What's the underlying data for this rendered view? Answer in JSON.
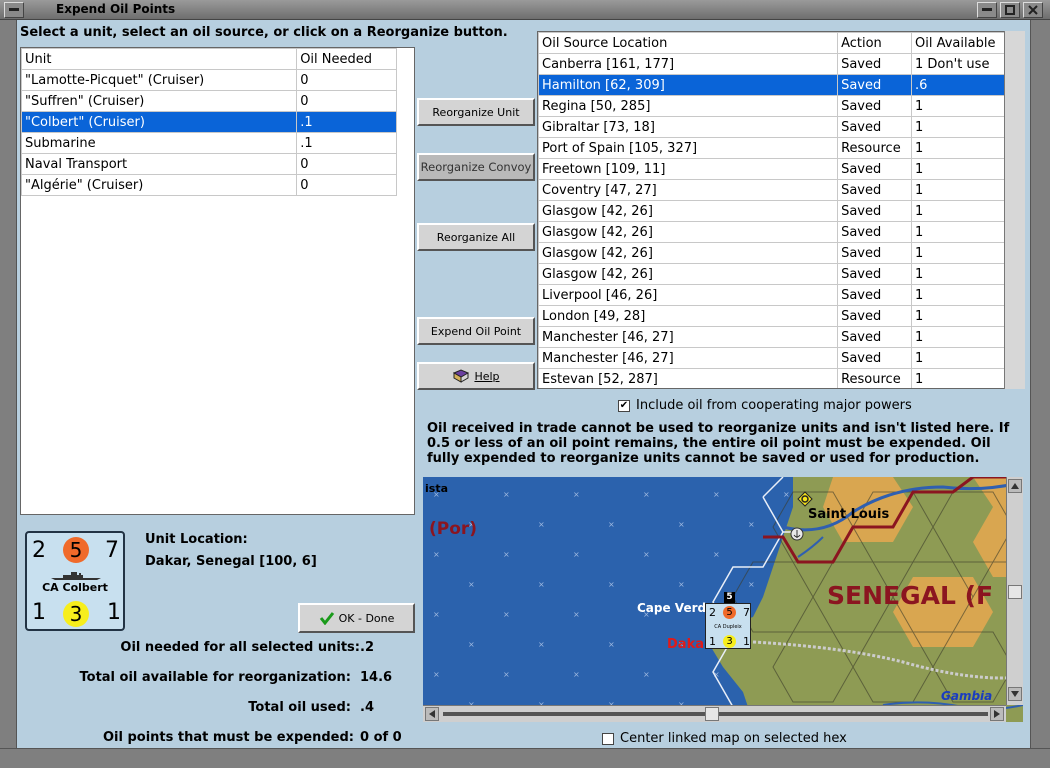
{
  "window": {
    "title": "Expend Oil Points"
  },
  "instructions": "Select a unit, select an oil source, or click on a Reorganize button.",
  "unit_table": {
    "headers": [
      "Unit",
      "Oil Needed"
    ],
    "rows": [
      {
        "unit": "\"Lamotte-Picquet\" (Cruiser)",
        "oil": "0"
      },
      {
        "unit": "\"Suffren\" (Cruiser)",
        "oil": "0"
      },
      {
        "unit": "\"Colbert\" (Cruiser)",
        "oil": ".1",
        "selected": true
      },
      {
        "unit": "Submarine",
        "oil": ".1"
      },
      {
        "unit": "Naval Transport",
        "oil": "0"
      },
      {
        "unit": "\"Algérie\" (Cruiser)",
        "oil": "0"
      }
    ]
  },
  "oil_table": {
    "headers": [
      "Oil Source Location",
      "Action",
      "Oil Available"
    ],
    "rows": [
      {
        "loc": "Canberra [161, 177]",
        "action": "Saved",
        "avail": "1 Don't use"
      },
      {
        "loc": "Hamilton [62, 309]",
        "action": "Saved",
        "avail": ".6",
        "selected": true
      },
      {
        "loc": "Regina [50, 285]",
        "action": "Saved",
        "avail": "1"
      },
      {
        "loc": "Gibraltar [73, 18]",
        "action": "Saved",
        "avail": "1"
      },
      {
        "loc": "Port of Spain [105, 327]",
        "action": "Resource",
        "avail": "1"
      },
      {
        "loc": "Freetown [109, 11]",
        "action": "Saved",
        "avail": "1"
      },
      {
        "loc": "Coventry [47, 27]",
        "action": "Saved",
        "avail": "1"
      },
      {
        "loc": "Glasgow [42, 26]",
        "action": "Saved",
        "avail": "1"
      },
      {
        "loc": "Glasgow [42, 26]",
        "action": "Saved",
        "avail": "1"
      },
      {
        "loc": "Glasgow [42, 26]",
        "action": "Saved",
        "avail": "1"
      },
      {
        "loc": "Glasgow [42, 26]",
        "action": "Saved",
        "avail": "1"
      },
      {
        "loc": "Liverpool [46, 26]",
        "action": "Saved",
        "avail": "1"
      },
      {
        "loc": "London [49, 28]",
        "action": "Saved",
        "avail": "1"
      },
      {
        "loc": "Manchester [46, 27]",
        "action": "Saved",
        "avail": "1"
      },
      {
        "loc": "Manchester [46, 27]",
        "action": "Saved",
        "avail": "1"
      },
      {
        "loc": "Estevan [52, 287]",
        "action": "Resource",
        "avail": "1"
      }
    ]
  },
  "buttons": {
    "reorganize_unit": "Reorganize Unit",
    "reorganize_convoy": "Reorganize Convoy",
    "reorganize_all": "Reorganize All",
    "expend_oil_point": "Expend Oil Point",
    "help": "Help",
    "ok_done": "OK - Done"
  },
  "include_cooperating": {
    "label": "Include oil from cooperating major powers",
    "checked": true
  },
  "note": "Oil received in trade cannot be used to reorganize units and isn't listed here.  If 0.5 or less of an oil point remains, the entire oil point must be expended.   Oil fully expended to reorganize units cannot be saved or used for production.",
  "unit_counter": {
    "top_left": "2",
    "top_mid": "5",
    "top_right": "7",
    "name": "CA Colbert",
    "bottom_left": "1",
    "bottom_mid": "3",
    "bottom_right": "1"
  },
  "unit_location": {
    "label": "Unit Location:",
    "value": "Dakar, Senegal [100, 6]"
  },
  "stats": [
    {
      "label": "Oil needed for all selected units:",
      "value": ".2"
    },
    {
      "label": "Total oil available for reorganization:",
      "value": "14.6"
    },
    {
      "label": "Total oil used:",
      "value": ".4"
    },
    {
      "label": "Oil points that must be expended:",
      "value": "0 of 0"
    }
  ],
  "map": {
    "label_ista": "ista",
    "label_por": "(Por)",
    "label_saint_louis": "Saint Louis",
    "label_senegal": "SENEGAL (F",
    "label_cape_verde": "Cape Verd",
    "label_dakar": "Daka",
    "label_gambia": "Gambia",
    "stack_count": "5",
    "map_counter": {
      "tl": "2",
      "tm": "5",
      "tr": "7",
      "name": "CA Dupleix",
      "bl": "1",
      "bm": "3",
      "br": "1"
    }
  },
  "center_linked": {
    "label": "Center linked map on selected hex",
    "checked": false
  }
}
